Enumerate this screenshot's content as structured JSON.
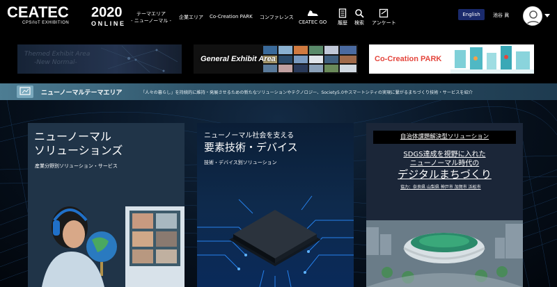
{
  "header": {
    "logo_text": "CEATEC",
    "logo_sub": "CPS/IoT EXHIBITION",
    "year": "2020",
    "online": "ONLINE",
    "nav_active_line1": "テーマエリア",
    "nav_active_line2": "- ニューノーマル -",
    "nav_companies": "企業エリア",
    "nav_cocreation": "Co-Creation PARK",
    "nav_conference": "コンファレンス",
    "nav_go": "CEATEC GO",
    "nav_history": "履歴",
    "nav_search": "検索",
    "nav_survey": "アンケート",
    "lang": "English",
    "user_name": "池谷 眞"
  },
  "banners": {
    "themed_line1": "Themed Exhibit Area",
    "themed_line2": "-New Normal-",
    "general": "General Exhibit Area",
    "cocreation": "Co-Creation PARK"
  },
  "section": {
    "title": "ニューノーマルテーマエリア",
    "description": "「人々の暮らし」を持続的に維持・発展させるための新たなソリューションやテクノロジー、Society5.0やスマートシティの実現に繋がるまちづくり技術・サービスを紹介"
  },
  "cards": {
    "card1": {
      "title_line1": "ニューノーマル",
      "title_line2": "ソリューションズ",
      "subtitle": "産業分野別ソリューション・サービス"
    },
    "card2": {
      "title_small": "ニューノーマル社会を支える",
      "title": "要素技術・デバイス",
      "subtitle": "技術・デバイス別ソリューション"
    },
    "card3": {
      "tag": "自治体課題解決型ソリューション",
      "line1": "SDGS達成を視野に入れた",
      "line2": "ニューノーマル時代の",
      "line3": "デジタルまちづくり",
      "cooperation": "協力：奈良県 山梨県 神戸市 加賀市 浜松市"
    }
  },
  "colors": {
    "background": "#000000",
    "section_bar": "#2f556b",
    "lang_button": "#1a2a6c",
    "cocreation_red": "#e4453c"
  }
}
